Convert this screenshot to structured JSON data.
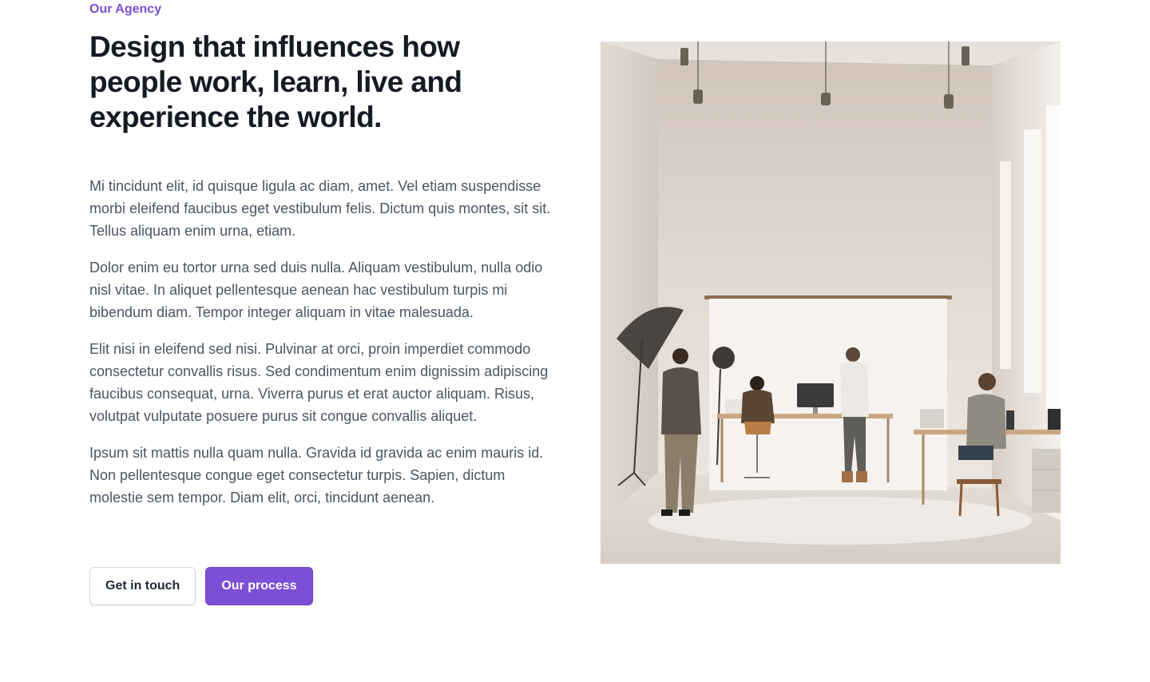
{
  "eyebrow": "Our Agency",
  "headline": "Design that influences how people work, learn, live and experience the world.",
  "paragraphs": [
    "Mi tincidunt elit, id quisque ligula ac diam, amet. Vel etiam suspendisse morbi eleifend faucibus eget vestibulum felis. Dictum quis montes, sit sit. Tellus aliquam enim urna, etiam.",
    "Dolor enim eu tortor urna sed duis nulla. Aliquam vestibulum, nulla odio nisl vitae. In aliquet pellentesque aenean hac vestibulum turpis mi bibendum diam. Tempor integer aliquam in vitae malesuada.",
    "Elit nisi in eleifend sed nisi. Pulvinar at orci, proin imperdiet commodo consectetur convallis risus. Sed condimentum enim dignissim adipiscing faucibus consequat, urna. Viverra purus et erat auctor aliquam. Risus, volutpat vulputate posuere purus sit congue convallis aliquet.",
    "Ipsum sit mattis nulla quam nulla. Gravida id gravida ac enim mauris id. Non pellentesque congue eget consectetur turpis. Sapien, dictum molestie sem tempor. Diam elit, orci, tincidunt aenean."
  ],
  "buttons": {
    "secondary_label": "Get in touch",
    "primary_label": "Our process"
  },
  "colors": {
    "accent": "#7b4fd6",
    "eyebrow": "#7a4fd1",
    "heading": "#161a24",
    "body_text": "#4b5563"
  }
}
